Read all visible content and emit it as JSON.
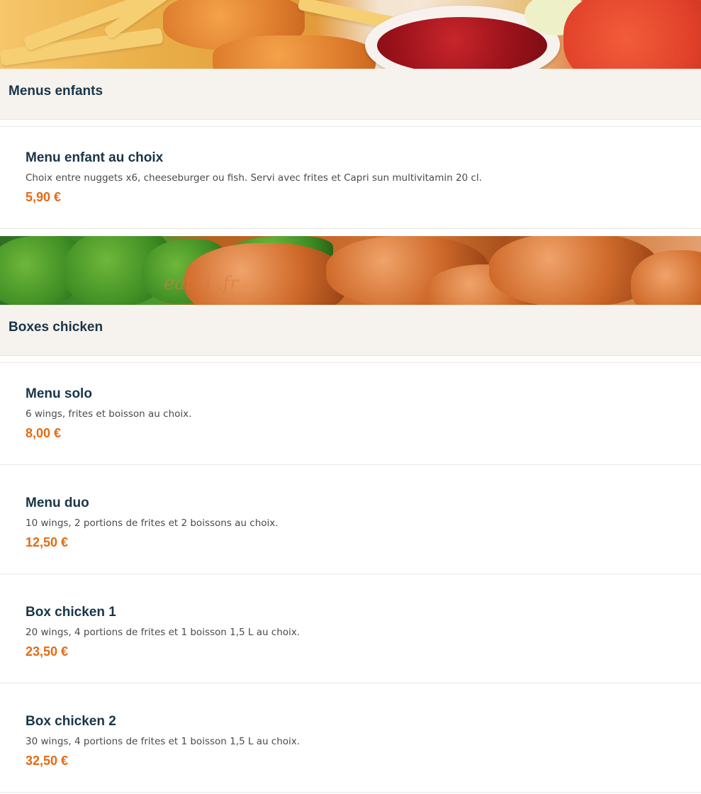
{
  "sections": [
    {
      "title": "Menus enfants",
      "items": [
        {
          "name": "Menu enfant au choix",
          "description": "Choix entre nuggets x6, cheeseburger ou fish. Servi avec frites et Capri sun multivitamin 20 cl.",
          "price": "5,90 €"
        }
      ]
    },
    {
      "title": "Boxes chicken",
      "items": [
        {
          "name": "Menu solo",
          "description": "6 wings, frites et boisson au choix.",
          "price": "8,00 €"
        },
        {
          "name": "Menu duo",
          "description": "10 wings, 2 portions de frites et 2 boissons au choix.",
          "price": "12,50 €"
        },
        {
          "name": "Box chicken 1",
          "description": "20 wings, 4 portions de frites et 1 boisson 1,5 L au choix.",
          "price": "23,50 €"
        },
        {
          "name": "Box chicken 2",
          "description": "30 wings, 4 portions de frites et 1 boisson 1,5 L au choix.",
          "price": "32,50 €"
        }
      ]
    }
  ],
  "watermark": "eat-li  .fr",
  "colors": {
    "accent": "#e46a12",
    "heading": "#193549",
    "section_bg": "#f6f2ee"
  },
  "banners": [
    "fries-nuggets-ketchup-banner",
    "chicken-wings-salad-banner"
  ]
}
